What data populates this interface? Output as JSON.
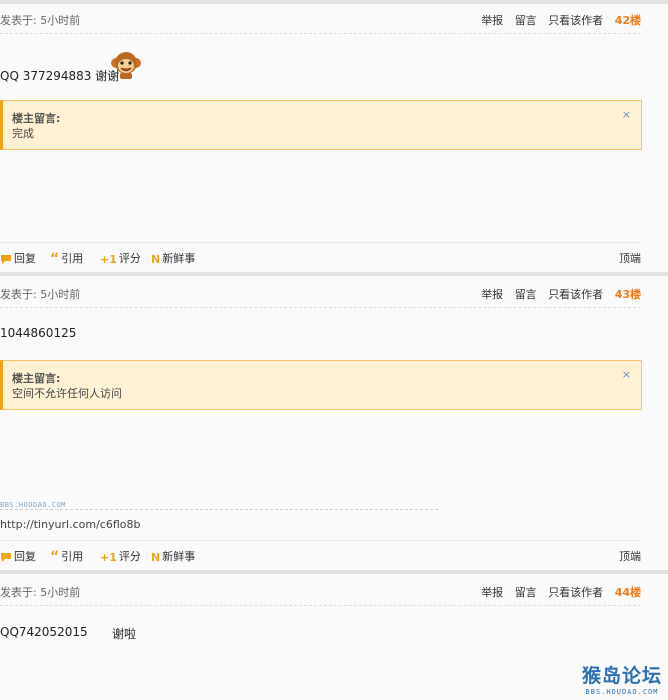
{
  "posts": [
    {
      "posted_time": "发表于: 5小时前",
      "actions_meta": {
        "report": "举报",
        "leave_message": "留言",
        "author_only": "只看该作者",
        "floor": "42楼"
      },
      "content": "QQ 377294883 谢谢",
      "owner_note": {
        "title": "楼主留言:",
        "text": "完成",
        "close": "×"
      },
      "action_bar": {
        "reply": "回复",
        "quote": "引用",
        "rate": "评分",
        "news": "新鲜事",
        "top": "顶端"
      }
    },
    {
      "posted_time": "发表于: 5小时前",
      "actions_meta": {
        "report": "举报",
        "leave_message": "留言",
        "author_only": "只看该作者",
        "floor": "43楼"
      },
      "content": "1044860125",
      "owner_note": {
        "title": "楼主留言:",
        "text": "空间不允许任何人访问",
        "close": "×"
      },
      "signature": {
        "logo": "BBS.HOUDAO.COM",
        "url": "http://tinyurl.com/c6flo8b"
      },
      "action_bar": {
        "reply": "回复",
        "quote": "引用",
        "rate": "评分",
        "news": "新鲜事",
        "top": "顶端"
      }
    },
    {
      "posted_time": "发表于: 5小时前",
      "actions_meta": {
        "report": "举报",
        "leave_message": "留言",
        "author_only": "只看该作者",
        "floor": "44楼"
      },
      "content_left": "QQ742052015",
      "content_right": "谢啦"
    }
  ],
  "watermark": {
    "main": "猴岛论坛",
    "sub": "BBS.HOUDAO.COM"
  },
  "colors": {
    "floor": "#ef7b1a",
    "note_bg": "#fff1d4",
    "note_border": "#f3c16b",
    "accent_bar": "#f0a21a"
  }
}
